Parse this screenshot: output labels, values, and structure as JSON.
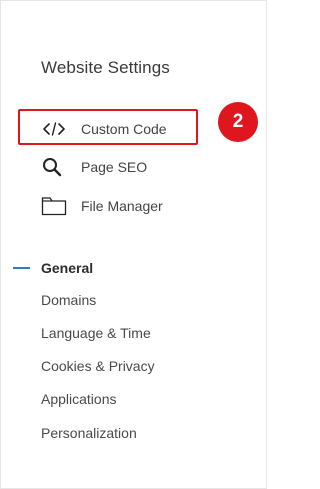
{
  "panel": {
    "title": "Website Settings",
    "menu": [
      {
        "label": "Custom Code",
        "icon": "code-icon"
      },
      {
        "label": "Page SEO",
        "icon": "search-icon"
      },
      {
        "label": "File Manager",
        "icon": "folder-icon"
      }
    ],
    "badge": "2",
    "sections": {
      "active": "General",
      "items": [
        "Domains",
        "Language & Time",
        "Cookies & Privacy",
        "Applications",
        "Personalization"
      ]
    },
    "colors": {
      "highlight": "#e0161f",
      "active_indicator": "#2f7bd6"
    }
  }
}
